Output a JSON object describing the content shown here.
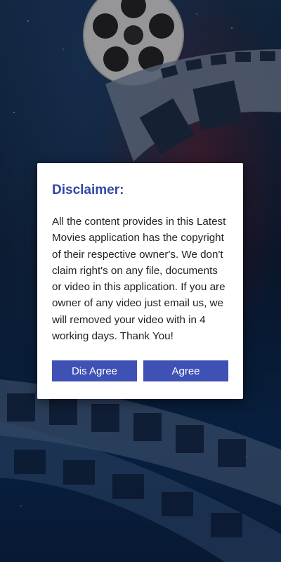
{
  "dialog": {
    "title": "Disclaimer:",
    "message": "All the content provides in this Latest Movies application has the copyright of their respective owner's. We don't claim right's on any file, documents or video in this application. If you are owner of any video just email us, we will removed your video with in 4 working days. Thank You!",
    "disagree_label": "Dis Agree",
    "agree_label": "Agree"
  },
  "colors": {
    "accent": "#3f51b5",
    "title": "#3147a7"
  },
  "icons": {
    "background": "film-reel-icon"
  }
}
